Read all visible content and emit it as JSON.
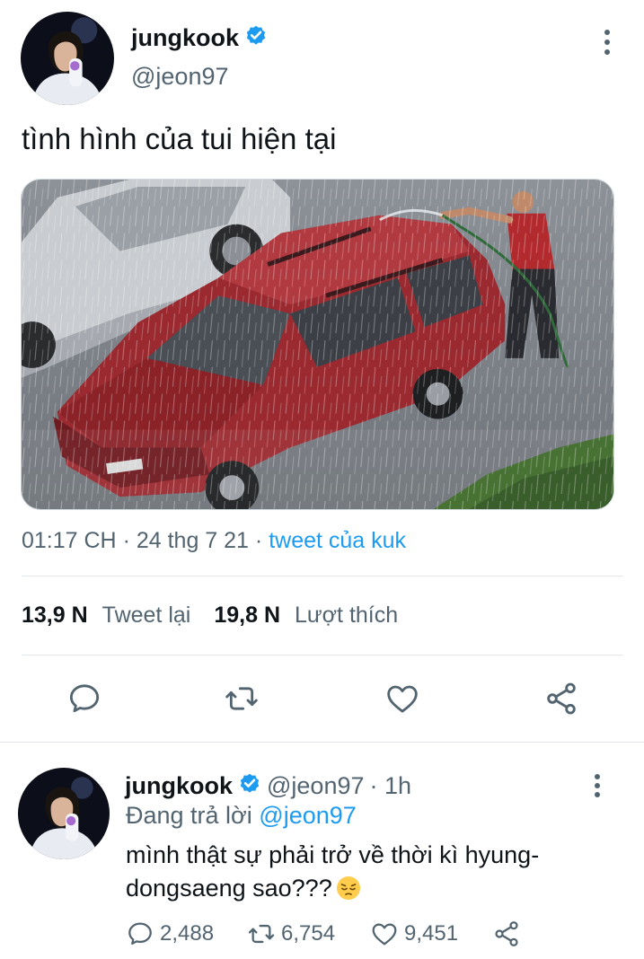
{
  "tweet": {
    "author_name": "jungkook",
    "author_handle": "@jeon97",
    "text": "tình hình của tui hiện tại",
    "time": "01:17 CH",
    "sep": " · ",
    "date": "24 thg 7 21",
    "source": "tweet của kuk",
    "retweets": "13,9 N",
    "retweets_label": "Tweet lại",
    "likes": "19,8 N",
    "likes_label": "Lượt thích"
  },
  "reply": {
    "author_name": "jungkook",
    "author_handle": "@jeon97",
    "age": "· 1h",
    "replying_label": "Đang trả lời",
    "replying_to": "@jeon97",
    "text": "mình thật sự phải trở về thời kì hyung-dongsaeng sao???",
    "replies": "2,488",
    "retweets": "6,754",
    "likes": "9,451"
  },
  "colors": {
    "accent": "#1d9bf0",
    "secondary_text": "#536471",
    "primary_text": "#0f1419"
  },
  "icons": {
    "verified": "verified-badge-icon",
    "more": "more-vertical-icon",
    "reply": "comment-bubble-icon",
    "retweet": "retweet-arrows-icon",
    "like": "heart-icon",
    "share": "share-icon",
    "emoji": "pensive-face-emoji"
  }
}
